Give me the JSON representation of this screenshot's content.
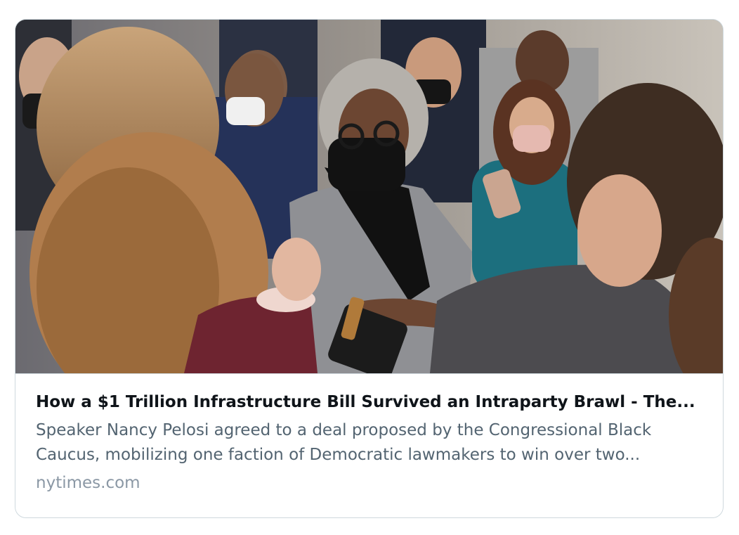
{
  "link_card": {
    "title": "How a $1 Trillion Infrastructure Bill Survived an Intraparty Brawl - The...",
    "description": "Speaker Nancy Pelosi agreed to a deal proposed by the Congressional Black Caucus, mobilizing one faction of Democratic lawmakers to win over two...",
    "domain": "nytimes.com",
    "image": {
      "icon": "news-photo-image"
    }
  },
  "colors": {
    "title": "#0f1419",
    "description": "#536471",
    "domain": "#8b98a5",
    "border": "#cfd9de"
  }
}
